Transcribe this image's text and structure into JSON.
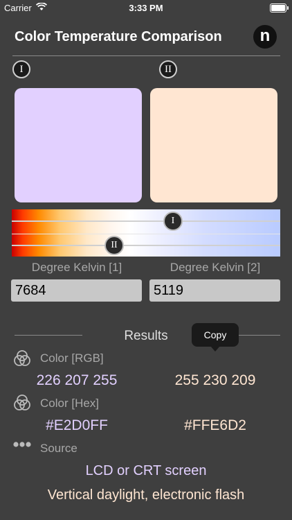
{
  "status_bar": {
    "carrier": "Carrier",
    "time": "3:33 PM"
  },
  "header": {
    "title": "Color Temperature Comparison",
    "logo": "n"
  },
  "markers": {
    "first": "I",
    "second": "II"
  },
  "swatches": {
    "first_color": "#E2D0FF",
    "second_color": "#FFE6D2"
  },
  "kelvin": {
    "label_1": "Degree Kelvin [1]",
    "label_2": "Degree Kelvin [2]",
    "value_1": "7684",
    "value_2": "5119"
  },
  "results": {
    "title": "Results",
    "tooltip": "Copy",
    "rgb_label": "Color [RGB]",
    "rgb_1": "226 207 255",
    "rgb_2": "255 230 209",
    "hex_label": "Color [Hex]",
    "hex_1": "#E2D0FF",
    "hex_2": "#FFE6D2",
    "source_label": "Source",
    "source_1": "LCD or CRT screen",
    "source_2": "Vertical daylight, electronic flash"
  },
  "icons": {
    "wifi": "wifi-icon",
    "battery": "battery-icon",
    "rgb": "color-circles-icon",
    "hex": "color-circles-icon",
    "source": "dots-icon"
  }
}
